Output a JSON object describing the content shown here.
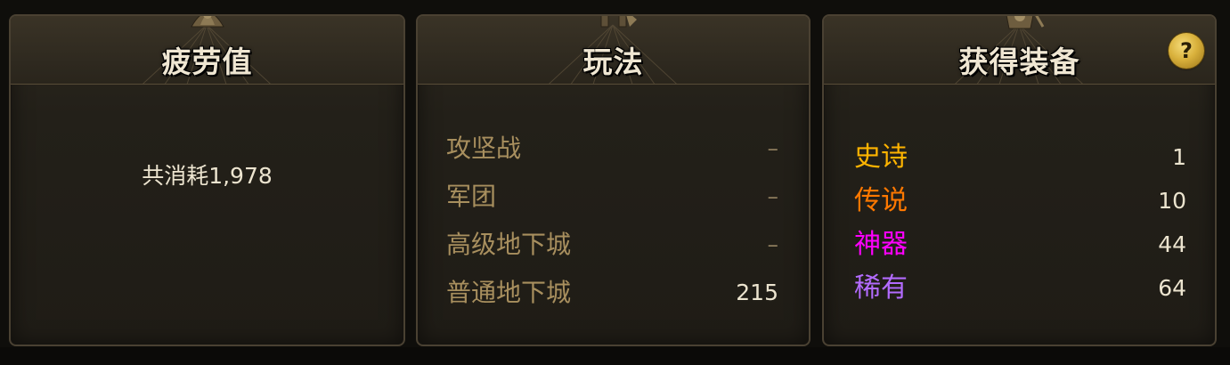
{
  "fatigue": {
    "title": "疲劳值",
    "consumed_text": "共消耗1,978"
  },
  "modes": {
    "title": "玩法",
    "rows": [
      {
        "name": "攻坚战",
        "value": "–"
      },
      {
        "name": "军团",
        "value": "–"
      },
      {
        "name": "高级地下城",
        "value": "–"
      },
      {
        "name": "普通地下城",
        "value": "215"
      }
    ]
  },
  "equipment": {
    "title": "获得装备",
    "help_icon_label": "?",
    "rows": [
      {
        "name": "史诗",
        "value": "1",
        "color": "#ffb400"
      },
      {
        "name": "传说",
        "value": "10",
        "color": "#ff7800"
      },
      {
        "name": "神器",
        "value": "44",
        "color": "#ff00ff"
      },
      {
        "name": "稀有",
        "value": "64",
        "color": "#b36bff"
      }
    ]
  }
}
